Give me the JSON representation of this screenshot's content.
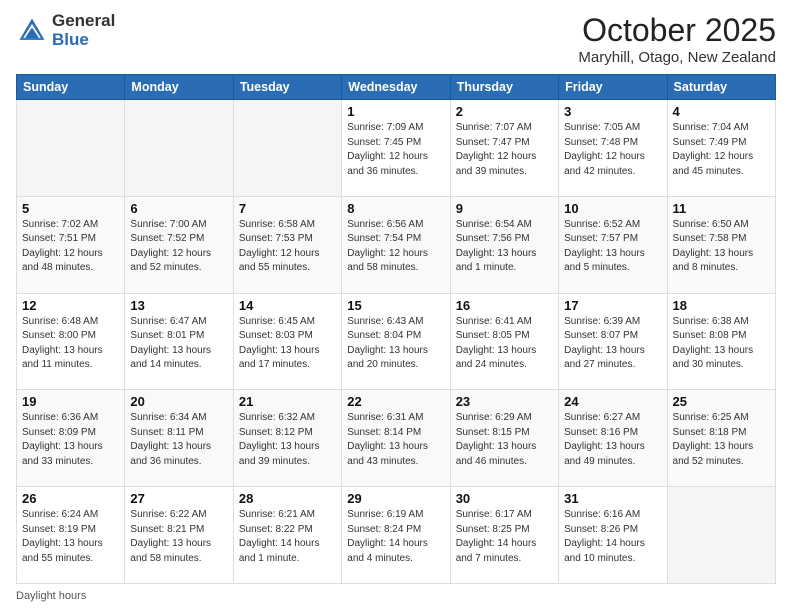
{
  "header": {
    "logo_general": "General",
    "logo_blue": "Blue",
    "month_title": "October 2025",
    "location": "Maryhill, Otago, New Zealand"
  },
  "days_of_week": [
    "Sunday",
    "Monday",
    "Tuesday",
    "Wednesday",
    "Thursday",
    "Friday",
    "Saturday"
  ],
  "weeks": [
    [
      {
        "day": "",
        "info": ""
      },
      {
        "day": "",
        "info": ""
      },
      {
        "day": "",
        "info": ""
      },
      {
        "day": "1",
        "info": "Sunrise: 7:09 AM\nSunset: 7:45 PM\nDaylight: 12 hours\nand 36 minutes."
      },
      {
        "day": "2",
        "info": "Sunrise: 7:07 AM\nSunset: 7:47 PM\nDaylight: 12 hours\nand 39 minutes."
      },
      {
        "day": "3",
        "info": "Sunrise: 7:05 AM\nSunset: 7:48 PM\nDaylight: 12 hours\nand 42 minutes."
      },
      {
        "day": "4",
        "info": "Sunrise: 7:04 AM\nSunset: 7:49 PM\nDaylight: 12 hours\nand 45 minutes."
      }
    ],
    [
      {
        "day": "5",
        "info": "Sunrise: 7:02 AM\nSunset: 7:51 PM\nDaylight: 12 hours\nand 48 minutes."
      },
      {
        "day": "6",
        "info": "Sunrise: 7:00 AM\nSunset: 7:52 PM\nDaylight: 12 hours\nand 52 minutes."
      },
      {
        "day": "7",
        "info": "Sunrise: 6:58 AM\nSunset: 7:53 PM\nDaylight: 12 hours\nand 55 minutes."
      },
      {
        "day": "8",
        "info": "Sunrise: 6:56 AM\nSunset: 7:54 PM\nDaylight: 12 hours\nand 58 minutes."
      },
      {
        "day": "9",
        "info": "Sunrise: 6:54 AM\nSunset: 7:56 PM\nDaylight: 13 hours\nand 1 minute."
      },
      {
        "day": "10",
        "info": "Sunrise: 6:52 AM\nSunset: 7:57 PM\nDaylight: 13 hours\nand 5 minutes."
      },
      {
        "day": "11",
        "info": "Sunrise: 6:50 AM\nSunset: 7:58 PM\nDaylight: 13 hours\nand 8 minutes."
      }
    ],
    [
      {
        "day": "12",
        "info": "Sunrise: 6:48 AM\nSunset: 8:00 PM\nDaylight: 13 hours\nand 11 minutes."
      },
      {
        "day": "13",
        "info": "Sunrise: 6:47 AM\nSunset: 8:01 PM\nDaylight: 13 hours\nand 14 minutes."
      },
      {
        "day": "14",
        "info": "Sunrise: 6:45 AM\nSunset: 8:03 PM\nDaylight: 13 hours\nand 17 minutes."
      },
      {
        "day": "15",
        "info": "Sunrise: 6:43 AM\nSunset: 8:04 PM\nDaylight: 13 hours\nand 20 minutes."
      },
      {
        "day": "16",
        "info": "Sunrise: 6:41 AM\nSunset: 8:05 PM\nDaylight: 13 hours\nand 24 minutes."
      },
      {
        "day": "17",
        "info": "Sunrise: 6:39 AM\nSunset: 8:07 PM\nDaylight: 13 hours\nand 27 minutes."
      },
      {
        "day": "18",
        "info": "Sunrise: 6:38 AM\nSunset: 8:08 PM\nDaylight: 13 hours\nand 30 minutes."
      }
    ],
    [
      {
        "day": "19",
        "info": "Sunrise: 6:36 AM\nSunset: 8:09 PM\nDaylight: 13 hours\nand 33 minutes."
      },
      {
        "day": "20",
        "info": "Sunrise: 6:34 AM\nSunset: 8:11 PM\nDaylight: 13 hours\nand 36 minutes."
      },
      {
        "day": "21",
        "info": "Sunrise: 6:32 AM\nSunset: 8:12 PM\nDaylight: 13 hours\nand 39 minutes."
      },
      {
        "day": "22",
        "info": "Sunrise: 6:31 AM\nSunset: 8:14 PM\nDaylight: 13 hours\nand 43 minutes."
      },
      {
        "day": "23",
        "info": "Sunrise: 6:29 AM\nSunset: 8:15 PM\nDaylight: 13 hours\nand 46 minutes."
      },
      {
        "day": "24",
        "info": "Sunrise: 6:27 AM\nSunset: 8:16 PM\nDaylight: 13 hours\nand 49 minutes."
      },
      {
        "day": "25",
        "info": "Sunrise: 6:25 AM\nSunset: 8:18 PM\nDaylight: 13 hours\nand 52 minutes."
      }
    ],
    [
      {
        "day": "26",
        "info": "Sunrise: 6:24 AM\nSunset: 8:19 PM\nDaylight: 13 hours\nand 55 minutes."
      },
      {
        "day": "27",
        "info": "Sunrise: 6:22 AM\nSunset: 8:21 PM\nDaylight: 13 hours\nand 58 minutes."
      },
      {
        "day": "28",
        "info": "Sunrise: 6:21 AM\nSunset: 8:22 PM\nDaylight: 14 hours\nand 1 minute."
      },
      {
        "day": "29",
        "info": "Sunrise: 6:19 AM\nSunset: 8:24 PM\nDaylight: 14 hours\nand 4 minutes."
      },
      {
        "day": "30",
        "info": "Sunrise: 6:17 AM\nSunset: 8:25 PM\nDaylight: 14 hours\nand 7 minutes."
      },
      {
        "day": "31",
        "info": "Sunrise: 6:16 AM\nSunset: 8:26 PM\nDaylight: 14 hours\nand 10 minutes."
      },
      {
        "day": "",
        "info": ""
      }
    ]
  ],
  "footer": {
    "daylight_label": "Daylight hours"
  }
}
